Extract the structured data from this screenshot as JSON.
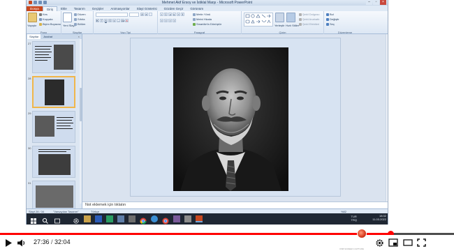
{
  "window": {
    "title": "Mehmet Akif Ersoy ve İstiklal Marşı - Microsoft PowerPoint"
  },
  "ribbon": {
    "tabs": [
      "Dosya",
      "Giriş",
      "Ekle",
      "Tasarım",
      "Geçişler",
      "Animasyonlar",
      "Slayt Gösterisi",
      "Gözden Geçir",
      "Görünüm"
    ],
    "active_tab": "Giriş",
    "groups": {
      "clipboard": {
        "name": "Pano",
        "paste": "Yapıştır",
        "cut": "Kes",
        "copy": "Kopyala",
        "format_painter": "Biçim Boyacısı"
      },
      "slides": {
        "name": "Slaytlar",
        "new_slide": "Yeni Slayt",
        "layout": "Düzen",
        "reset": "Sıfırla",
        "section": "Bölüm"
      },
      "font": {
        "name": "Yazı Tipi"
      },
      "paragraph": {
        "name": "Paragraf",
        "text_direction": "Metin Yönü",
        "align_text": "Metni Hizala",
        "smartart": "SmartArt'a Dönüştür"
      },
      "drawing": {
        "name": "Çizim",
        "arrange": "Yerleştir",
        "quick_styles": "Hızlı Stiller",
        "shape_fill": "Şekil Dolgusu",
        "shape_outline": "Şekil Anahattı",
        "shape_effects": "Şekil Efektleri"
      },
      "editing": {
        "name": "Düzenleme",
        "find": "Bul",
        "replace": "Değiştir",
        "select": "Seç"
      }
    }
  },
  "left_pane": {
    "tabs": [
      "Slaytlar",
      "Anahat"
    ],
    "close": "×",
    "slides": [
      {
        "number": "27"
      },
      {
        "number": "28",
        "selected": true
      },
      {
        "number": "29"
      },
      {
        "number": "30"
      },
      {
        "number": "31"
      }
    ]
  },
  "notes": {
    "placeholder": "Not eklemek için tıklatın"
  },
  "status_bar": {
    "slide_info": "Slayt 28 / 34",
    "theme": "\"Varsayılan Tasarım\"",
    "language": "Türkçe",
    "zoom": "%82"
  },
  "taskbar": {
    "language": "TUR\nTRQ",
    "time": "18:32",
    "date": "11.03.2022"
  },
  "video": {
    "current_time": "27:36",
    "separator": " / ",
    "duration": "32:04",
    "progress": 0.861,
    "recorder_label": "OSB SCREEN CAPTURE"
  },
  "colors": {
    "file_tab": "#c8481f",
    "ribbon": "#dce7f4",
    "taskbar": "#1f2733",
    "progress": "#ff0000"
  }
}
